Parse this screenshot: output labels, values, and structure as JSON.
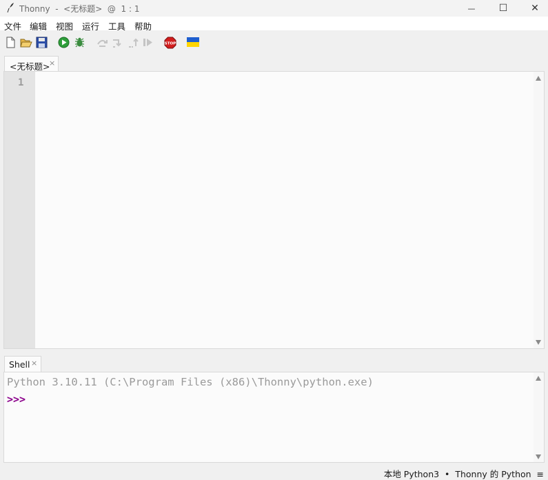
{
  "window": {
    "title": "Thonny  -  <无标题>  @  1 : 1",
    "minimize": "—",
    "maximize": "☐",
    "close": "✕"
  },
  "menu": [
    "文件",
    "编辑",
    "视图",
    "运行",
    "工具",
    "帮助"
  ],
  "toolbar": {
    "icons": [
      "new-file-icon",
      "open-file-icon",
      "save-icon",
      "run-icon",
      "debug-icon",
      "step-over-icon",
      "step-into-icon",
      "step-out-icon",
      "resume-icon",
      "stop-icon",
      "ukraine-flag-icon"
    ],
    "stop_label": "STOP"
  },
  "editor": {
    "tab_label": "<无标题>",
    "tab_close": "×",
    "line_numbers": [
      "1"
    ]
  },
  "shell": {
    "tab_label": "Shell",
    "tab_close": "×",
    "version_line": "Python 3.10.11 (C:\\Program Files (x86)\\Thonny\\python.exe)",
    "prompt": ">>>"
  },
  "status": {
    "interpreter": "本地 Python3  •  Thonny 的 Python  ≡"
  },
  "colors": {
    "prompt": "#8b008b",
    "run_green": "#2e9e3a",
    "stop_red": "#d11d1d"
  }
}
